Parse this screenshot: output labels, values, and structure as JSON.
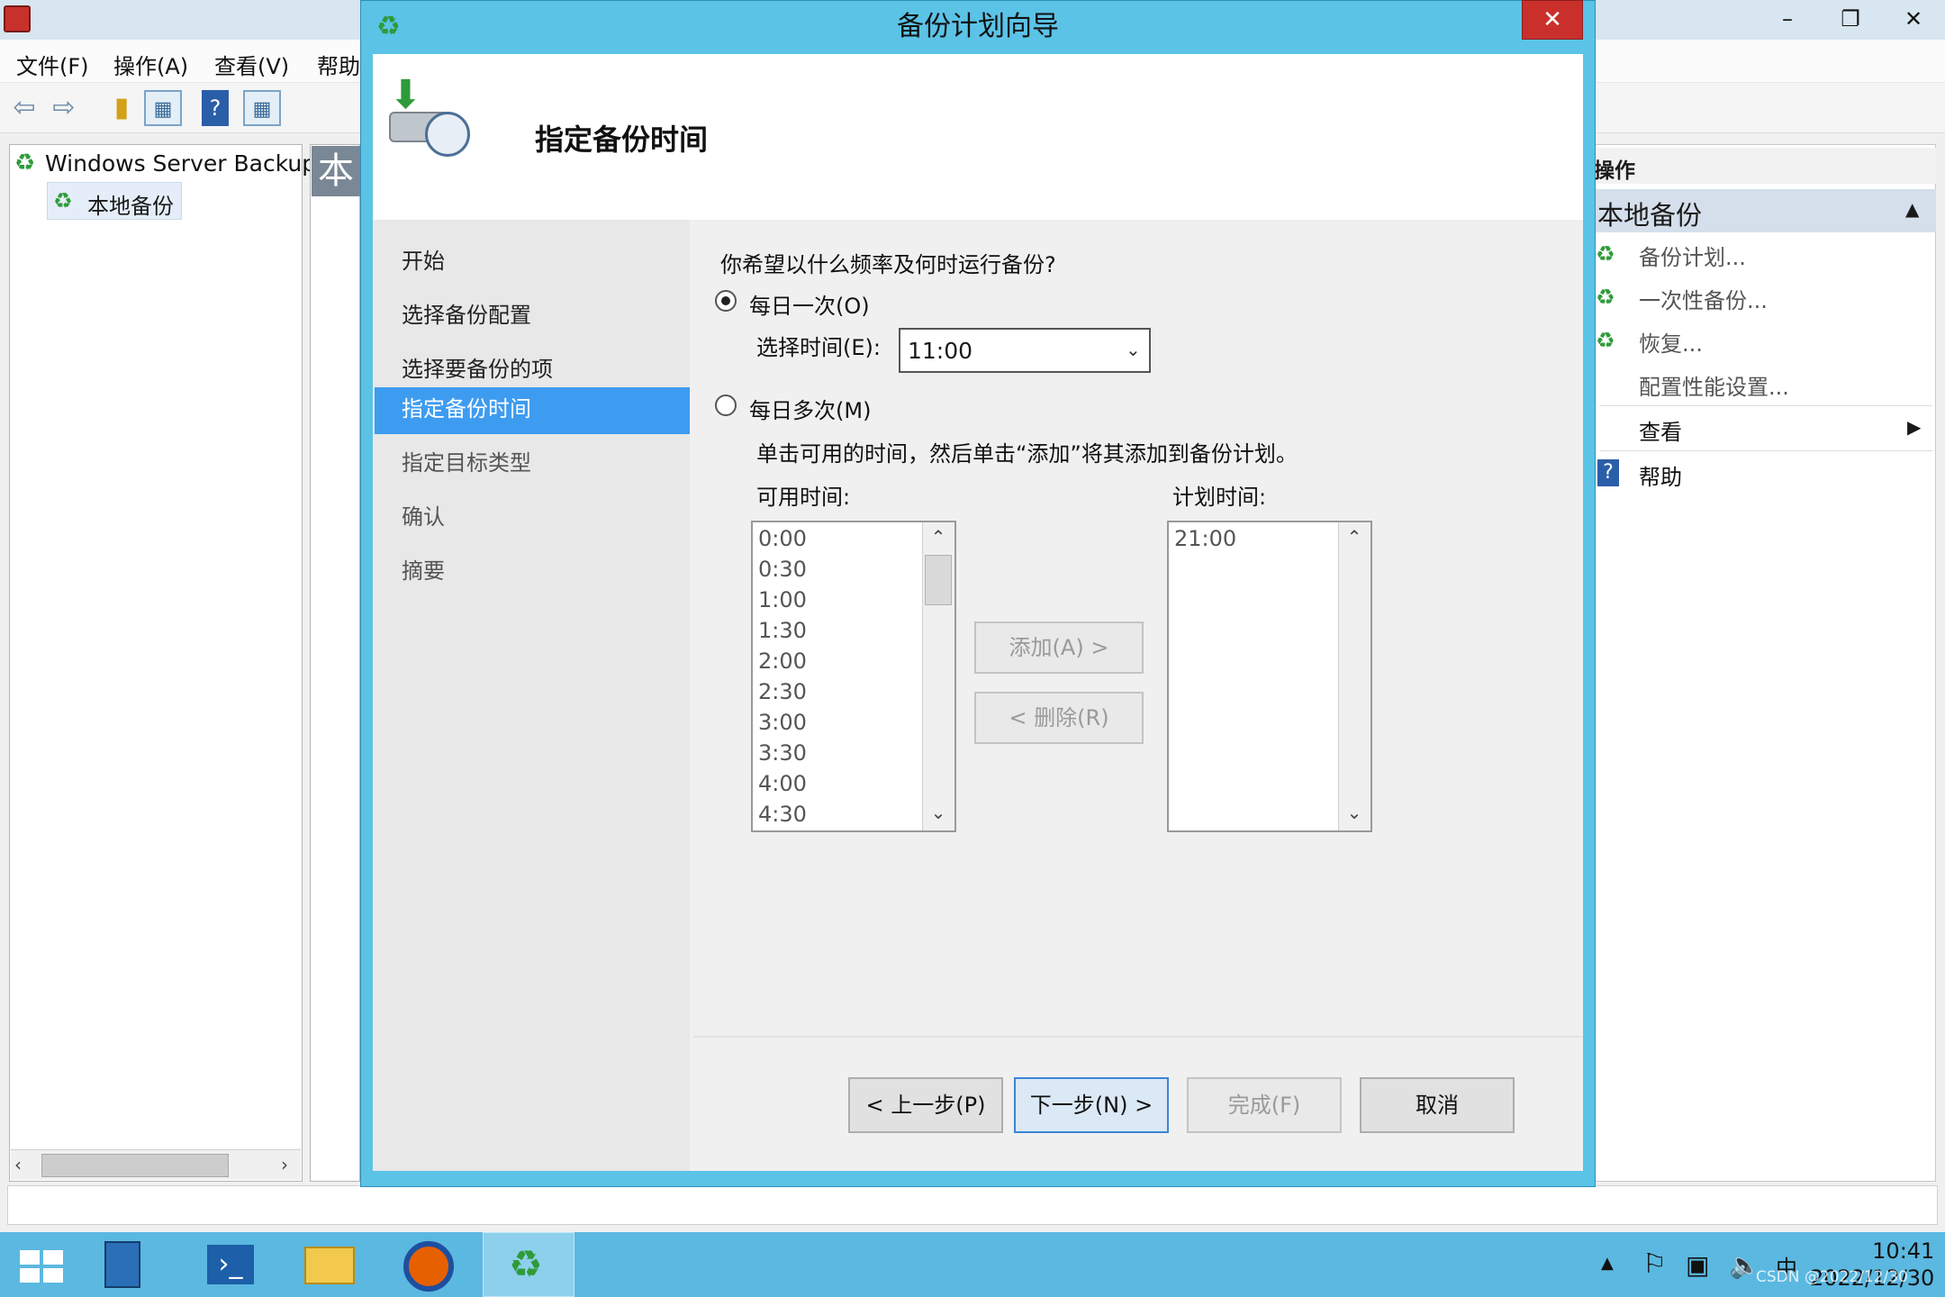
{
  "mmc": {
    "menu": [
      "文件(F)",
      "操作(A)",
      "查看(V)",
      "帮助"
    ],
    "tree_root": "Windows Server Backup",
    "tree_child": "本地备份",
    "center_header": "本",
    "actions_header": "操作",
    "actions_section": "本地备份",
    "actions": [
      "备份计划...",
      "一次性备份...",
      "恢复...",
      "配置性能设置..."
    ],
    "view_label": "查看",
    "help_label": "帮助",
    "window_controls": {
      "minimize": "–",
      "restore": "❐",
      "close": "✕"
    }
  },
  "dialog": {
    "title": "备份计划向导",
    "close": "✕",
    "heading": "指定备份时间",
    "steps": [
      "开始",
      "选择备份配置",
      "选择要备份的项",
      "指定备份时间",
      "指定目标类型",
      "确认",
      "摘要"
    ],
    "active_step": "指定备份时间",
    "question": "你希望以什么频率及何时运行备份?",
    "once_label": "每日一次(O)",
    "select_time_label": "选择时间(E):",
    "select_time_value": "11:00",
    "multi_label": "每日多次(M)",
    "instructions": "单击可用的时间，然后单击“添加”将其添加到备份计划。",
    "available_label": "可用时间:",
    "scheduled_label": "计划时间:",
    "available_times": [
      "0:00",
      "0:30",
      "1:00",
      "1:30",
      "2:00",
      "2:30",
      "3:00",
      "3:30",
      "4:00",
      "4:30"
    ],
    "scheduled_times": [
      "21:00"
    ],
    "add_button": "添加(A) >",
    "remove_button": "< 删除(R)",
    "back_button": "< 上一步(P)",
    "next_button": "下一步(N) >",
    "finish_button": "完成(F)",
    "cancel_button": "取消"
  },
  "taskbar": {
    "time": "10:41",
    "date": "2022/12/30",
    "ime": "中",
    "watermark": "CSDN @2022/12/30"
  },
  "colors": {
    "accent": "#3e9cf0",
    "dialog_frame": "#5bc3e6",
    "close": "#c9302c",
    "taskbar": "#5bb8e0"
  }
}
